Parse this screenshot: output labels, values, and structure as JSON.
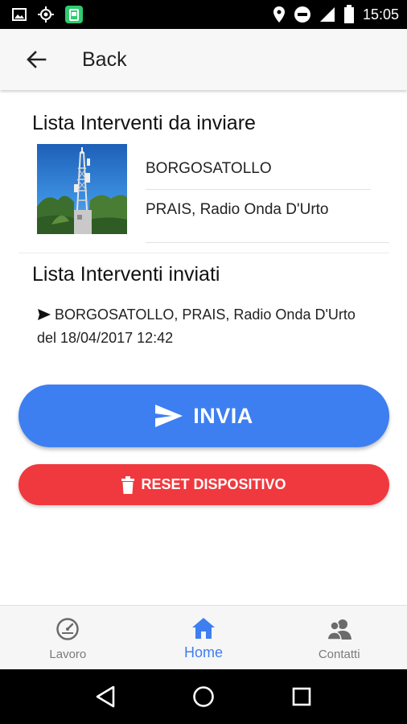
{
  "status_bar": {
    "time": "15:05",
    "left_icons": [
      "image-icon",
      "gps-icon",
      "android-app-icon"
    ],
    "right_icons": [
      "location-icon",
      "do-not-disturb-icon",
      "signal-icon",
      "battery-icon"
    ]
  },
  "app_bar": {
    "title": "Back"
  },
  "pending": {
    "title": "Lista Interventi da inviare",
    "item": {
      "line1": "BORGOSATOLLO",
      "line2": "PRAIS, Radio Onda D'Urto"
    }
  },
  "sent": {
    "title": "Lista Interventi inviati",
    "entries": [
      {
        "line1": "BORGOSATOLLO, PRAIS, Radio Onda D'Urto",
        "line2": "del 18/04/2017 12:42"
      }
    ]
  },
  "buttons": {
    "send_label": "INVIA",
    "reset_label": "RESET DISPOSITIVO"
  },
  "bottom_nav": {
    "items": [
      {
        "label": "Lavoro",
        "icon": "speedometer-icon",
        "active": false
      },
      {
        "label": "Home",
        "icon": "home-icon",
        "active": true
      },
      {
        "label": "Contatti",
        "icon": "contacts-icon",
        "active": false
      }
    ]
  },
  "colors": {
    "primary_blue": "#3d7ff0",
    "danger_red": "#f0393e",
    "status_bar": "#000000",
    "app_bar": "#f7f7f7"
  }
}
